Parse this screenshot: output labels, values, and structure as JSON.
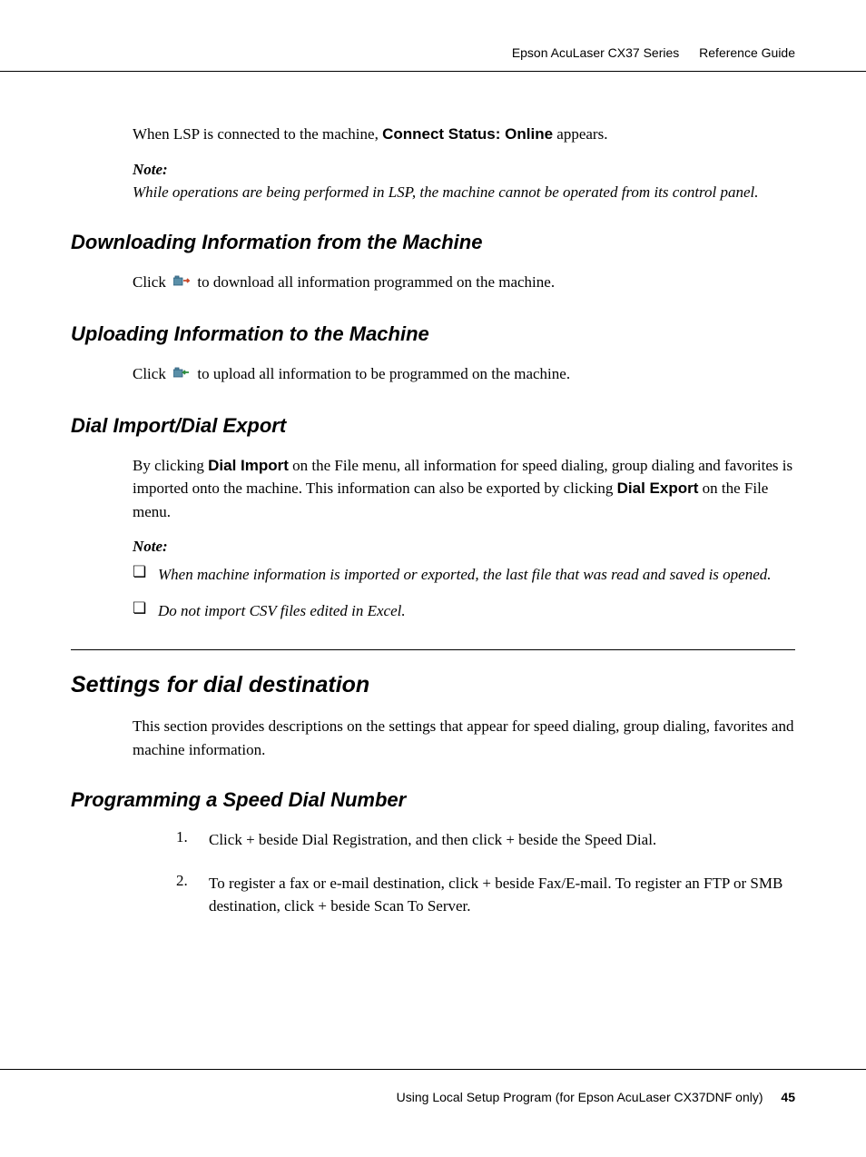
{
  "header": {
    "product": "Epson AcuLaser CX37 Series",
    "doc": "Reference Guide"
  },
  "intro": {
    "line_pre": "When LSP is connected to the machine, ",
    "line_bold": "Connect Status: Online",
    "line_post": " appears."
  },
  "note1": {
    "label": "Note:",
    "text": "While operations are being performed in LSP, the machine cannot be operated from its control panel."
  },
  "h_download": "Downloading Information from the Machine",
  "p_download_pre": "Click ",
  "p_download_post": " to download all information programmed on the machine.",
  "h_upload": "Uploading Information to the Machine",
  "p_upload_pre": "Click ",
  "p_upload_post": " to upload all information to be programmed on the machine.",
  "h_dial": "Dial Import/Dial Export",
  "p_dial": {
    "pre": "By clicking ",
    "b1": "Dial Import",
    "mid": " on the File menu, all information for speed dialing, group dialing and favorites is imported onto the machine. This information can also be exported by clicking ",
    "b2": "Dial Export",
    "post": " on the File menu."
  },
  "note2": {
    "label": "Note:",
    "items": [
      "When machine information is imported or exported, the last file that was read and saved is opened.",
      "Do not import CSV files edited in Excel."
    ]
  },
  "h_settings": "Settings for dial destination",
  "p_settings": "This section provides descriptions on the settings that appear for speed dialing, group dialing, favorites and machine information.",
  "h_program": "Programming a Speed Dial Number",
  "ol": {
    "n1": "1.",
    "t1": "Click + beside Dial Registration, and then click + beside the Speed Dial.",
    "n2": "2.",
    "t2": "To register a fax or e-mail destination, click + beside Fax/E-mail. To register an FTP or SMB destination, click + beside Scan To Server."
  },
  "footer": {
    "chapter": "Using Local Setup Program (for Epson AcuLaser CX37DNF only)",
    "page": "45"
  },
  "bullet_marker": "❏"
}
